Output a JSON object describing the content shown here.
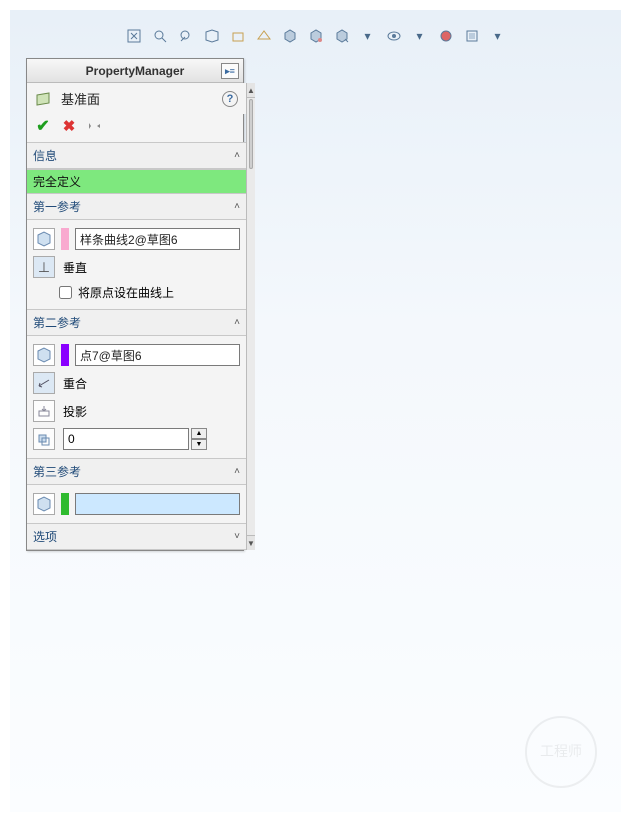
{
  "header": {
    "title": "PropertyManager"
  },
  "feature": {
    "name": "基准面"
  },
  "sections": {
    "info": {
      "label": "信息",
      "status": "完全定义"
    },
    "ref1": {
      "label": "第一参考",
      "value": "样条曲线2@草图6",
      "constraint": "垂直",
      "checkbox": "将原点设在曲线上"
    },
    "ref2": {
      "label": "第二参考",
      "value": "点7@草图6",
      "c1": "重合",
      "c2": "投影",
      "offset": "0"
    },
    "ref3": {
      "label": "第三参考",
      "value": ""
    },
    "options": {
      "label": "选项"
    }
  },
  "colors": {
    "ref1_swatch": "#f9a9cf",
    "ref2_swatch": "#8a00ff",
    "ref3_swatch": "#2fbb2f"
  }
}
